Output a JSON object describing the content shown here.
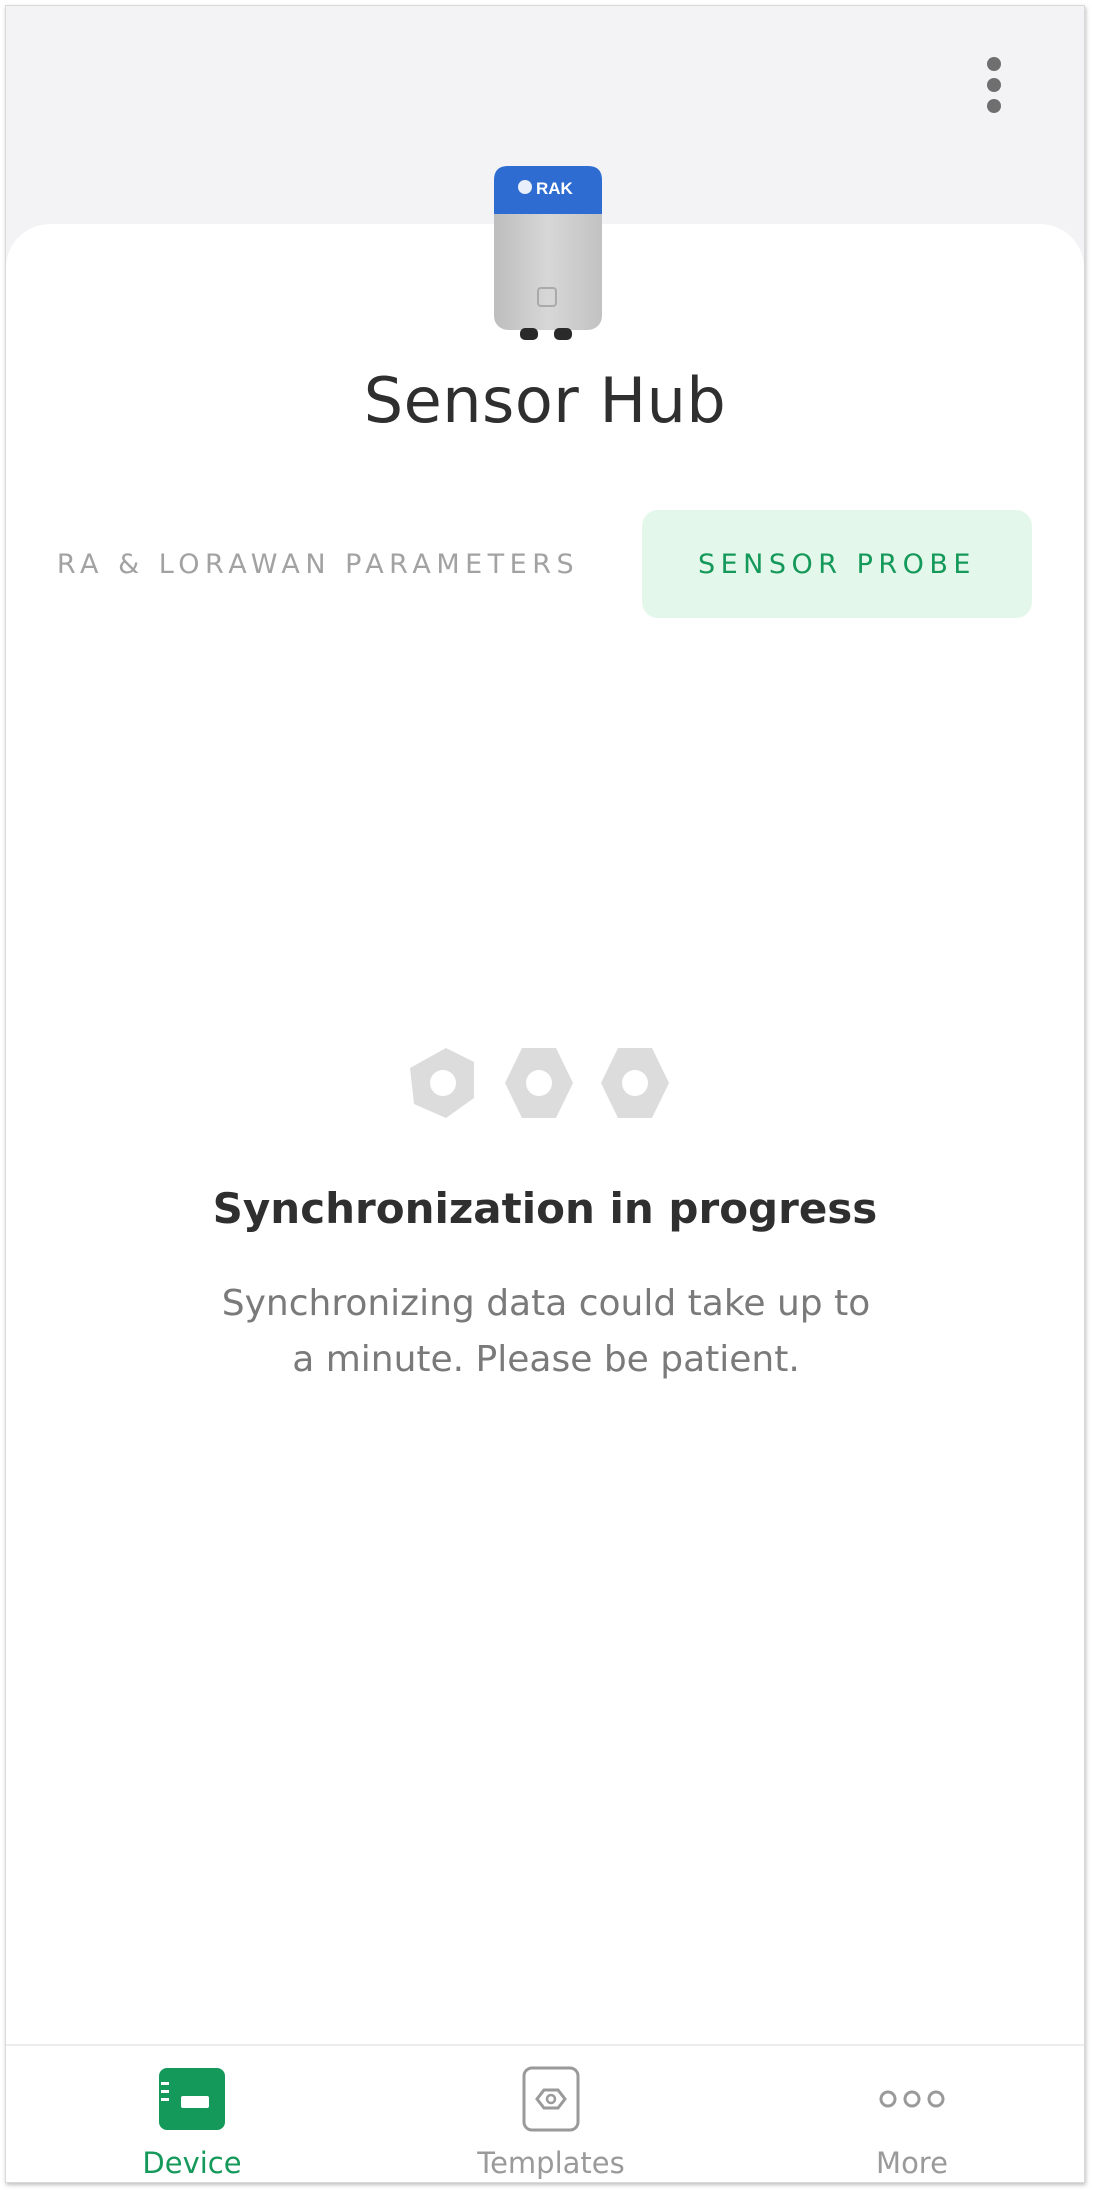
{
  "app": {
    "device_name": "Sensor Hub",
    "device_image_brand": "RAK"
  },
  "tabs": [
    {
      "label": "RA & LORAWAN PARAMETERS",
      "selected": false
    },
    {
      "label": "SENSOR PROBE",
      "selected": true
    }
  ],
  "sync": {
    "title": "Synchronization in progress",
    "message": "Synchronizing data could take up to a minute. Please be patient."
  },
  "bottom_nav": [
    {
      "label": "Device",
      "icon": "device-icon",
      "active": true
    },
    {
      "label": "Templates",
      "icon": "template-icon",
      "active": false
    },
    {
      "label": "More",
      "icon": "more-dots-icon",
      "active": false
    }
  ],
  "colors": {
    "accent": "#14995a",
    "tab_selected_bg": "#e4f7eb",
    "header_bg": "#f3f3f6",
    "device_top": "#2f6cd1"
  }
}
